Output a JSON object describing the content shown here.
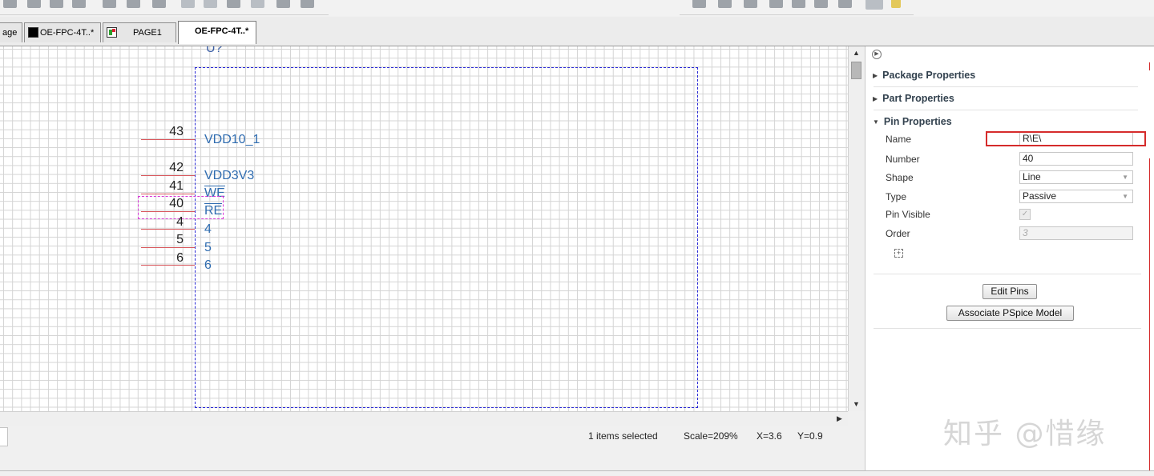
{
  "tabs": [
    {
      "label": "age",
      "icon": "none"
    },
    {
      "label": "OE-FPC-4T..*",
      "icon": "schematic-icon"
    },
    {
      "label": "PAGE1",
      "icon": "page-icon"
    },
    {
      "label": "OE-FPC-4T..*",
      "icon": "none",
      "active": true
    }
  ],
  "part": {
    "reference": "U?",
    "pins": [
      {
        "number": "43",
        "name": "VDD10_1",
        "overbar": false
      },
      {
        "number": "42",
        "name": "VDD3V3",
        "overbar": false
      },
      {
        "number": "41",
        "name": "WE",
        "overbar": true
      },
      {
        "number": "40",
        "name": "RE",
        "overbar": true,
        "selected": true
      },
      {
        "number": "4",
        "name": "4",
        "overbar": false
      },
      {
        "number": "5",
        "name": "5",
        "overbar": false
      },
      {
        "number": "6",
        "name": "6",
        "overbar": false
      }
    ],
    "colors": {
      "body_border": "#2b2bd6",
      "pin_line": "#d9585d",
      "pin_name": "#2f6cb0",
      "selection": "#d83ad8"
    }
  },
  "status": {
    "items_selected": "1 items selected",
    "scale": "Scale=209%",
    "x": "X=3.6",
    "y": "Y=0.9"
  },
  "panel": {
    "sections": {
      "package": "Package Properties",
      "part": "Part Properties",
      "pin": "Pin Properties"
    },
    "pin_props": {
      "name_label": "Name",
      "name_value": "R\\E\\",
      "number_label": "Number",
      "number_value": "40",
      "shape_label": "Shape",
      "shape_value": "Line",
      "type_label": "Type",
      "type_value": "Passive",
      "visible_label": "Pin Visible",
      "visible_checked": true,
      "order_label": "Order",
      "order_value": "3"
    },
    "buttons": {
      "edit_pins": "Edit Pins",
      "associate_pspice": "Associate PSpice Model"
    },
    "highlight_color": "#d52b2b"
  },
  "watermark": "知乎 @惜缘"
}
